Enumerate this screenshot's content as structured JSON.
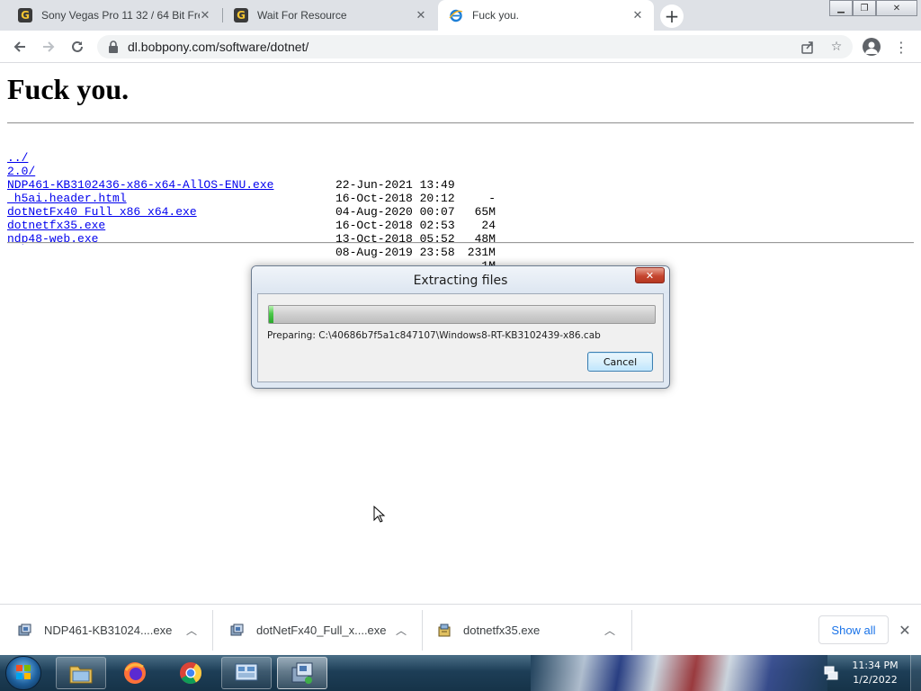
{
  "browser": {
    "tabs": [
      {
        "title": "Sony Vegas Pro 11 32 / 64 Bit Fre",
        "favicon": "G",
        "active": false
      },
      {
        "title": "Wait For Resource",
        "favicon": "G",
        "active": false
      },
      {
        "title": "Fuck you.",
        "favicon": "ie-icon",
        "active": true
      }
    ],
    "close_glyph": "✕",
    "new_tab_glyph": "+",
    "url": "dl.bobpony.com/software/dotnet/"
  },
  "page": {
    "heading": "Fuck you.",
    "listing": [
      {
        "name": "../",
        "date": "",
        "size": ""
      },
      {
        "name": "2.0/",
        "date": "22-Jun-2021 13:49",
        "size": "-"
      },
      {
        "name": "NDP461-KB3102436-x86-x64-AllOS-ENU.exe",
        "date": "16-Oct-2018 20:12",
        "size": "65M"
      },
      {
        "name": "_h5ai.header.html",
        "date": "04-Aug-2020 00:07",
        "size": "24"
      },
      {
        "name": "dotNetFx40_Full_x86_x64.exe",
        "date": "16-Oct-2018 02:53",
        "size": "48M"
      },
      {
        "name": "dotnetfx35.exe",
        "date": "13-Oct-2018 05:52",
        "size": "231M"
      },
      {
        "name": "ndp48-web.exe",
        "date": "08-Aug-2019 23:58",
        "size": "1M"
      }
    ]
  },
  "dialog": {
    "title": "Extracting files",
    "close_glyph": "✕",
    "progress": 0.01,
    "status": "Preparing: C:\\40686b7f5a1c847107\\Windows8-RT-KB3102439-x86.cab",
    "cancel_label": "Cancel"
  },
  "downloads": {
    "items": [
      {
        "name": "NDP461-KB31024....exe"
      },
      {
        "name": "dotNetFx40_Full_x....exe"
      },
      {
        "name": "dotnetfx35.exe"
      }
    ],
    "show_all_label": "Show all"
  },
  "taskbar": {
    "time": "11:34 PM",
    "date": "1/2/2022"
  },
  "colors": {
    "link": "#0000ee",
    "accent": "#1a73e8",
    "progress_green": "#4bc849"
  }
}
